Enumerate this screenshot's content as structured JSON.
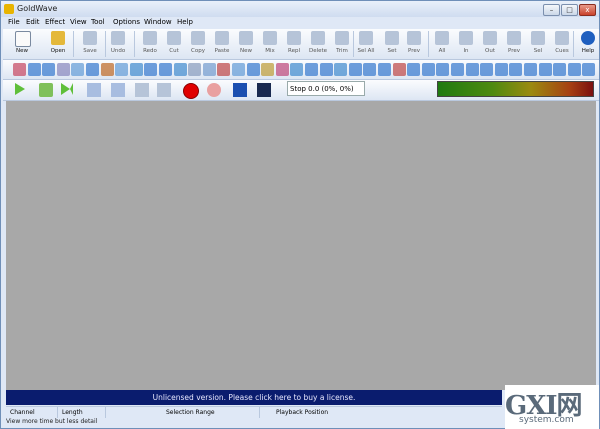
{
  "window": {
    "title": "GoldWave"
  },
  "window_buttons": [
    "–",
    "□",
    "x"
  ],
  "menu": [
    "File",
    "Edit",
    "Effect",
    "View",
    "Tool",
    "Options",
    "Window",
    "Help"
  ],
  "toolbar_main": [
    {
      "label": "New",
      "icon": "new-file-icon",
      "enabled": true
    },
    {
      "label": "Open",
      "icon": "open-folder-icon",
      "enabled": true
    },
    {
      "label": "Save",
      "icon": "save-icon",
      "enabled": false
    },
    {
      "label": "Undo",
      "icon": "undo-icon",
      "enabled": false
    },
    {
      "label": "Redo",
      "icon": "redo-icon",
      "enabled": false
    },
    {
      "label": "Cut",
      "icon": "cut-icon",
      "enabled": false
    },
    {
      "label": "Copy",
      "icon": "copy-icon",
      "enabled": false
    },
    {
      "label": "Paste",
      "icon": "paste-icon",
      "enabled": false
    },
    {
      "label": "New",
      "icon": "paste-new-icon",
      "enabled": false
    },
    {
      "label": "Mix",
      "icon": "mix-icon",
      "enabled": false
    },
    {
      "label": "Repl",
      "icon": "replace-icon",
      "enabled": false
    },
    {
      "label": "Delete",
      "icon": "delete-icon",
      "enabled": false
    },
    {
      "label": "Trim",
      "icon": "trim-icon",
      "enabled": false
    },
    {
      "label": "Sel All",
      "icon": "select-all-icon",
      "enabled": false
    },
    {
      "label": "Set",
      "icon": "set-icon",
      "enabled": false
    },
    {
      "label": "Prev",
      "icon": "previous-icon",
      "enabled": false
    },
    {
      "label": "All",
      "icon": "zoom-all-icon",
      "enabled": false
    },
    {
      "label": "In",
      "icon": "zoom-in-icon",
      "enabled": false
    },
    {
      "label": "Out",
      "icon": "zoom-out-icon",
      "enabled": false
    },
    {
      "label": "Prev",
      "icon": "zoom-previous-icon",
      "enabled": false
    },
    {
      "label": "Sel",
      "icon": "zoom-selection-icon",
      "enabled": false
    },
    {
      "label": "Cues",
      "icon": "cues-icon",
      "enabled": false
    },
    {
      "label": "Help",
      "icon": "help-icon",
      "enabled": true
    }
  ],
  "toolbar_effects_count": 40,
  "transport": {
    "status_text": "Stop 0.0 (0%, 0%)",
    "buttons": [
      "play-icon",
      "play-selection-icon",
      "play-to-end-icon",
      "rewind-icon",
      "fast-forward-icon",
      "pause-icon",
      "stop-icon",
      "record-icon",
      "record-selection-icon",
      "device-controls-icon",
      "monitor-window-icon"
    ]
  },
  "license_banner": "Unlicensed version. Please click here to buy a license.",
  "status_columns": [
    "Channel",
    "Length",
    "Selection Range",
    "Playback Position"
  ],
  "hint": "View more time but less detail",
  "watermark": {
    "logo": "GXI网",
    "domain": "system.com"
  },
  "colors": {
    "accent": "#0a1c6e",
    "workspace": "#a8a8a8",
    "record": "#e00000"
  }
}
